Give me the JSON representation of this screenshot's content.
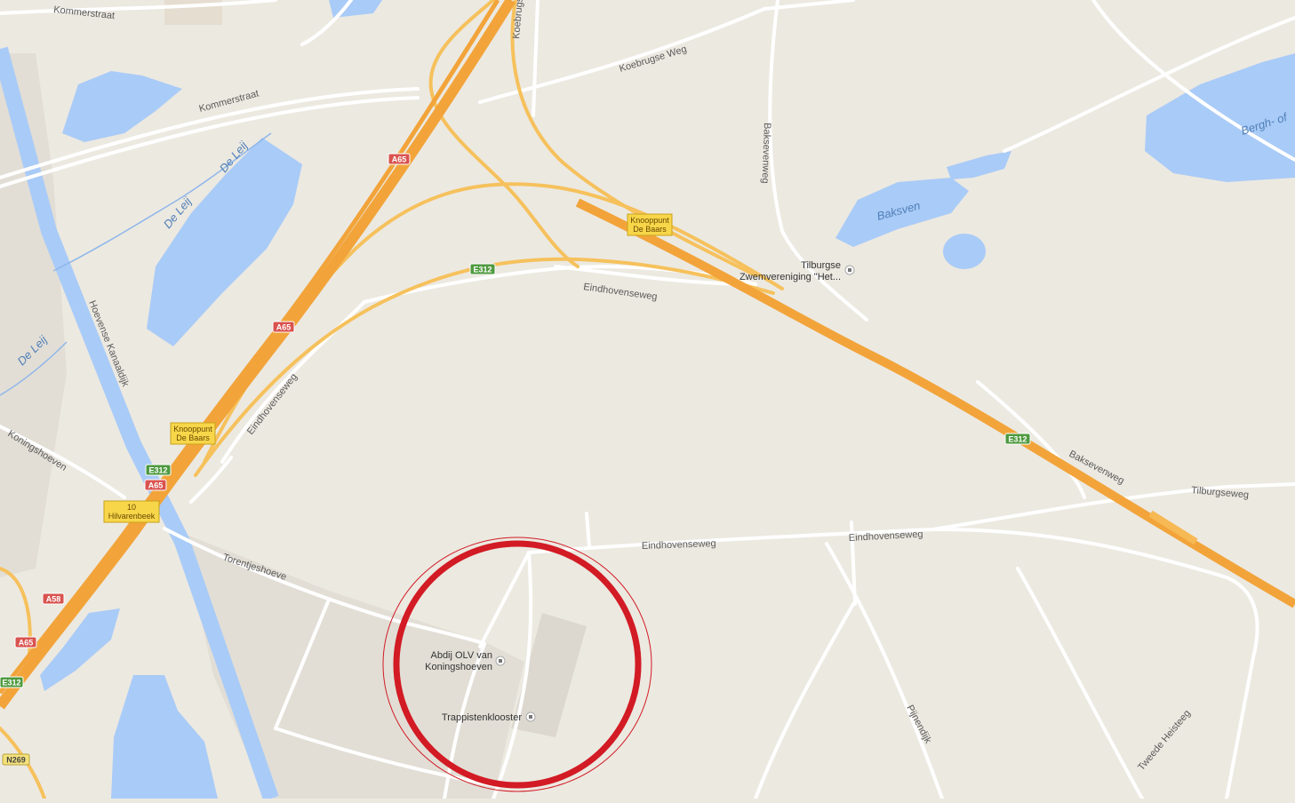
{
  "map": {
    "colors": {
      "land": "#ece9e1",
      "built": "#e2ded6",
      "water": "#a9cbf7",
      "highway": "#f2a43a",
      "ramp": "#f6c15c",
      "minor_road": "#ffffff",
      "highlight_circle": "#d21b24"
    },
    "roads": {
      "kommerstraat_top": "Kommerstraat",
      "kommerstraat": "Kommerstraat",
      "koebrugse_weg": "Koebrugse Weg",
      "koebrugse_vertical": "Koebrugse",
      "baksevenweg_vertical": "Baksevenweg",
      "baksevenweg_right": "Baksevenweg",
      "eindhovenseweg_top": "Eindhovenseweg",
      "eindhovenseweg_left": "Eindhovenseweg",
      "eindhovenseweg_bottom": "Eindhovenseweg",
      "eindhovenseweg_right": "Eindhovenseweg",
      "tilburgseweg": "Tilburgseweg",
      "hoevense_kanaaldijk": "Hoevense Kanaaldijk",
      "koningshoeven": "Koningshoeven",
      "torentjeshoeve": "Torentjeshoeve",
      "pijnendijk": "Pijnendijk",
      "tweede_heisteeg": "Tweede Heisteeg"
    },
    "water": {
      "de_leij_1": "De Leij",
      "de_leij_2": "De Leij",
      "de_leij_3": "De Leij",
      "baksven": "Baksven",
      "bergh": "Bergh- of"
    },
    "shields": {
      "a65_top": "A65",
      "a65_mid": "A65",
      "a65_low": "A65",
      "a65_bottom": "A65",
      "a58": "A58",
      "e312_top": "E312",
      "e312_right": "E312",
      "e312_left": "E312",
      "e312_bottom": "E312",
      "n269": "N269"
    },
    "junctions": {
      "de_baars_top_line1": "Knooppunt",
      "de_baars_top_line2": "De Baars",
      "de_baars_left_line1": "Knooppunt",
      "de_baars_left_line2": "De Baars",
      "exit_number": "10",
      "exit_name": "Hilvarenbeek"
    },
    "pois": {
      "zwemvereniging_line1": "Tilburgse",
      "zwemvereniging_line2": "Zwemvereniging \"Het...",
      "abdij_line1": "Abdij OLV van",
      "abdij_line2": "Koningshoeven",
      "trappistenklooster": "Trappistenklooster"
    }
  }
}
